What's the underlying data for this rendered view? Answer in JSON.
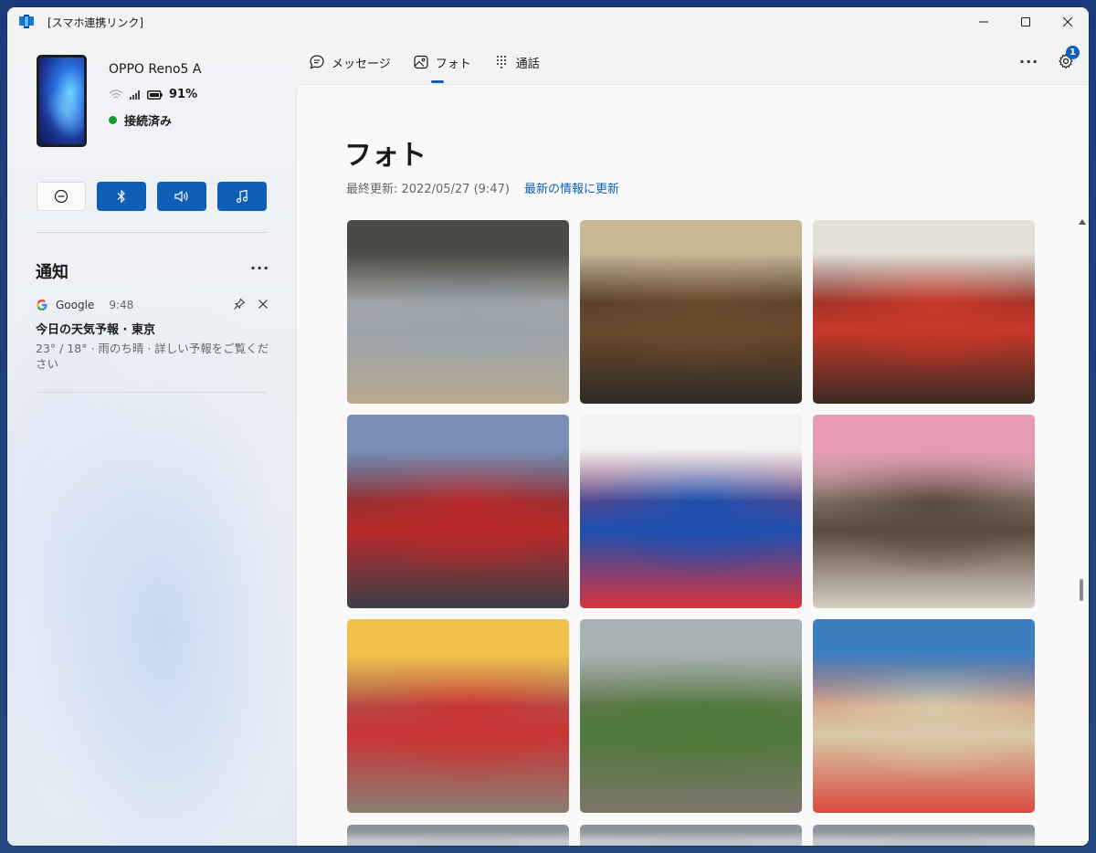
{
  "window": {
    "title": "[スマホ連携リンク]"
  },
  "device": {
    "name": "OPPO Reno5 A",
    "battery": "91%",
    "connection_status": "接続済み"
  },
  "quick_actions": [
    {
      "icon": "do-not-disturb-icon",
      "style": "light"
    },
    {
      "icon": "bluetooth-icon",
      "style": "blue"
    },
    {
      "icon": "volume-icon",
      "style": "blue"
    },
    {
      "icon": "music-note-icon",
      "style": "blue"
    }
  ],
  "notifications": {
    "title": "通知",
    "more": "···",
    "items": [
      {
        "app": "Google",
        "time": "9:48",
        "headline": "今日の天気予報 · 東京",
        "body": "23° / 18° · 雨のち晴 · 詳しい予報をご覧ください"
      }
    ]
  },
  "tabs": [
    {
      "label": "メッセージ",
      "icon": "message-icon",
      "active": false
    },
    {
      "label": "フォト",
      "icon": "photo-icon",
      "active": true
    },
    {
      "label": "通話",
      "icon": "dialpad-icon",
      "active": false
    }
  ],
  "header": {
    "more": "···",
    "settings_badge": "1"
  },
  "main": {
    "title": "フォト",
    "last_updated": "最終更新: 2022/05/27 (9:47)",
    "refresh_link": "最新の情報に更新"
  },
  "colors": {
    "accent": "#0f5fb7",
    "connected": "#0f9d3a"
  },
  "photos": [
    {
      "description": "osaka-shrine-street",
      "palette": [
        "#9aa3ad",
        "#4b4a46",
        "#b7a98e"
      ]
    },
    {
      "description": "hozenji-yokocho-gate",
      "palette": [
        "#6b4a2c",
        "#c9b894",
        "#2f2a25"
      ]
    },
    {
      "description": "kani-doraku-crab-sign",
      "palette": [
        "#c8382a",
        "#e3e0d8",
        "#3a2b22"
      ]
    },
    {
      "description": "dotonbori-big-screen",
      "palette": [
        "#b92a2a",
        "#7a8fb8",
        "#3b3f45"
      ]
    },
    {
      "description": "glico-running-man-sign",
      "palette": [
        "#1d4fb0",
        "#f2f2f2",
        "#d8343a"
      ]
    },
    {
      "description": "milk-ice-cream-shop",
      "palette": [
        "#5a4a3e",
        "#e79ab3",
        "#d6cfc2"
      ]
    },
    {
      "description": "takoyaki-restaurant-street",
      "palette": [
        "#c93535",
        "#f1c24a",
        "#8a7f72"
      ]
    },
    {
      "description": "park-with-big-tree",
      "palette": [
        "#4f7a3a",
        "#a8b2b5",
        "#7d766c"
      ]
    },
    {
      "description": "clothing-shop-street",
      "palette": [
        "#d7c9a7",
        "#3c7fbf",
        "#d94b3f"
      ]
    }
  ]
}
